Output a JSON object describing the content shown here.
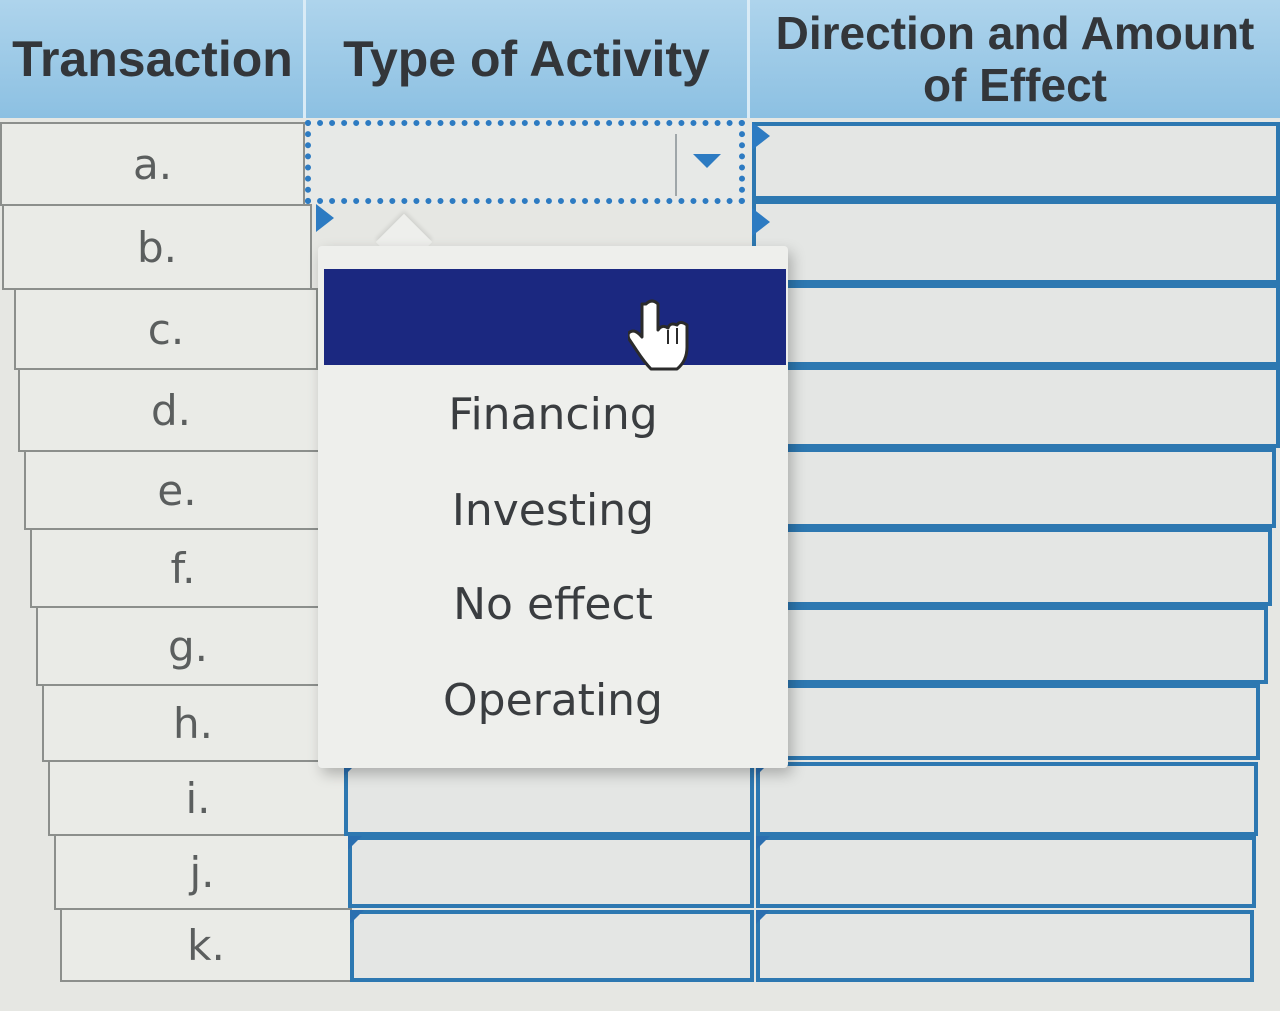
{
  "table": {
    "headers": {
      "transaction": "Transaction",
      "type": "Type of Activity",
      "direction_line1": "Direction and Amount",
      "direction_line2": "of Effect"
    },
    "rows": [
      "a.",
      "b.",
      "c.",
      "d.",
      "e.",
      "f.",
      "g.",
      "h.",
      "i.",
      "j.",
      "k."
    ]
  },
  "dropdown": {
    "selected": "",
    "options": [
      "",
      "Financing",
      "Investing",
      "No effect",
      "Operating"
    ]
  },
  "colors": {
    "header_blue": "#99c9e8",
    "highlight": "#1b2880",
    "input_border": "#2d78b1"
  },
  "icons": {
    "dropdown_arrow": "caret-down-icon",
    "cursor": "hand-pointer-icon"
  }
}
